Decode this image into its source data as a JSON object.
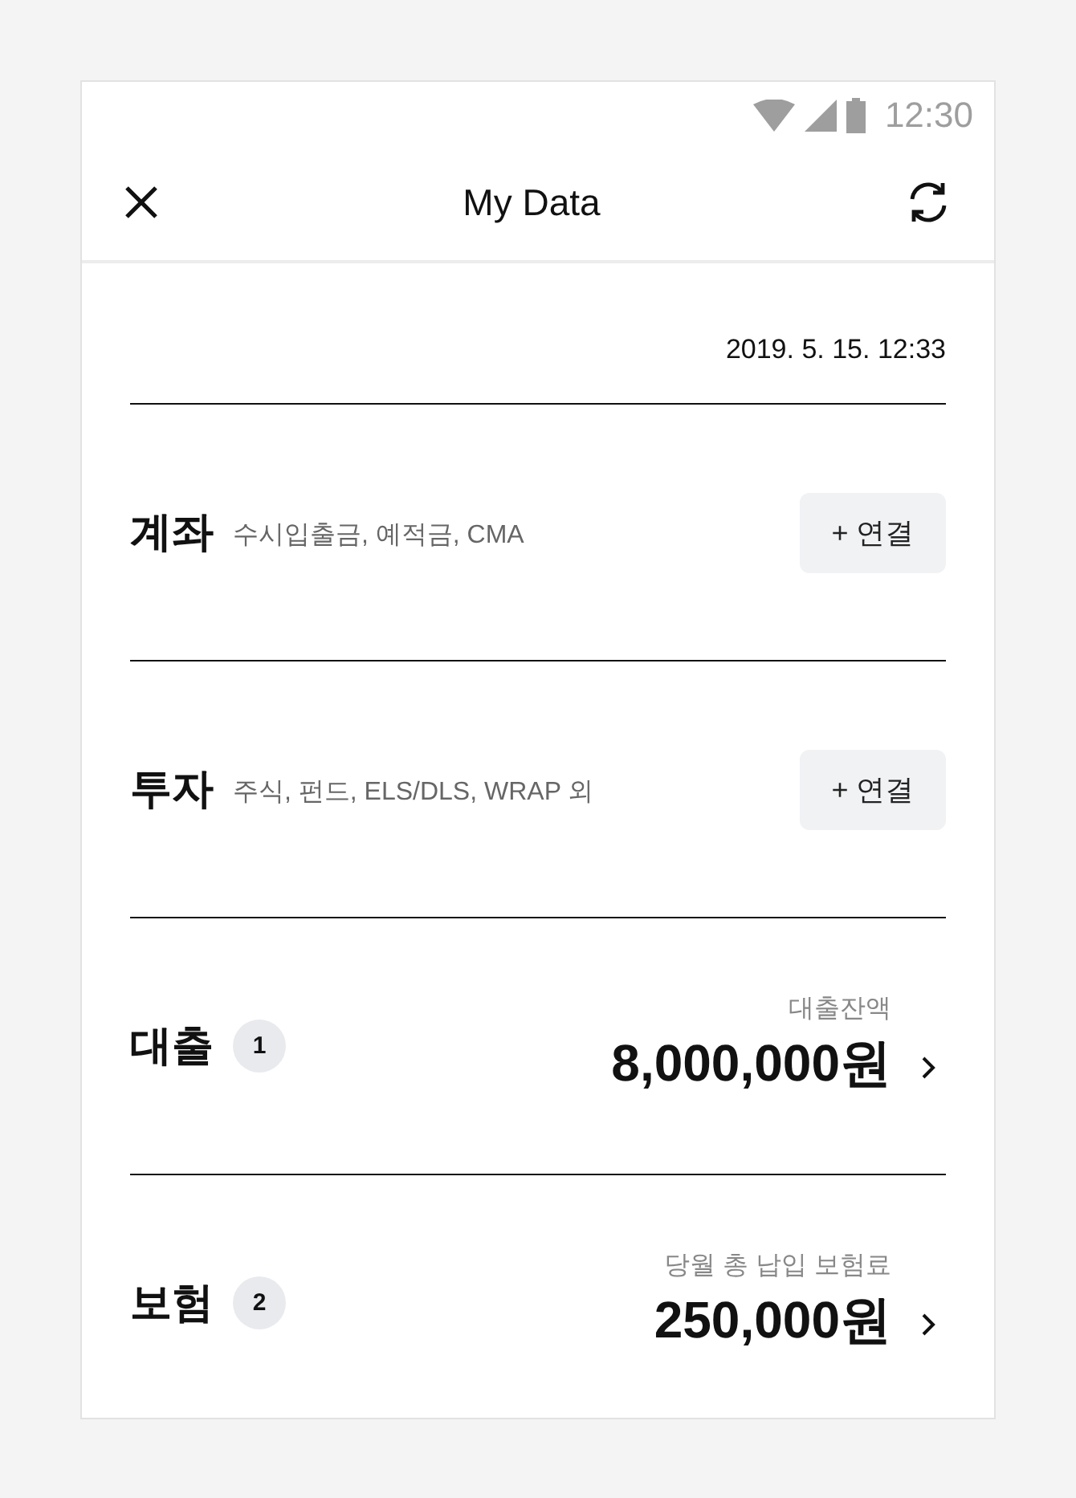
{
  "status_bar": {
    "time": "12:30"
  },
  "header": {
    "title": "My Data"
  },
  "updated": "2019. 5. 15. 12:33",
  "sections": [
    {
      "kind": "connect",
      "title": "계좌",
      "subtitle": "수시입출금, 예적금, CMA",
      "button": "+ 연결"
    },
    {
      "kind": "connect",
      "title": "투자",
      "subtitle": "주식, 펀드, ELS/DLS, WRAP 외",
      "button": "+ 연결"
    },
    {
      "kind": "amount",
      "title": "대출",
      "count": "1",
      "caption": "대출잔액",
      "amount": "8,000,000원"
    },
    {
      "kind": "amount",
      "title": "보험",
      "count": "2",
      "caption": "당월 총 납입 보험료",
      "amount": "250,000원"
    }
  ]
}
